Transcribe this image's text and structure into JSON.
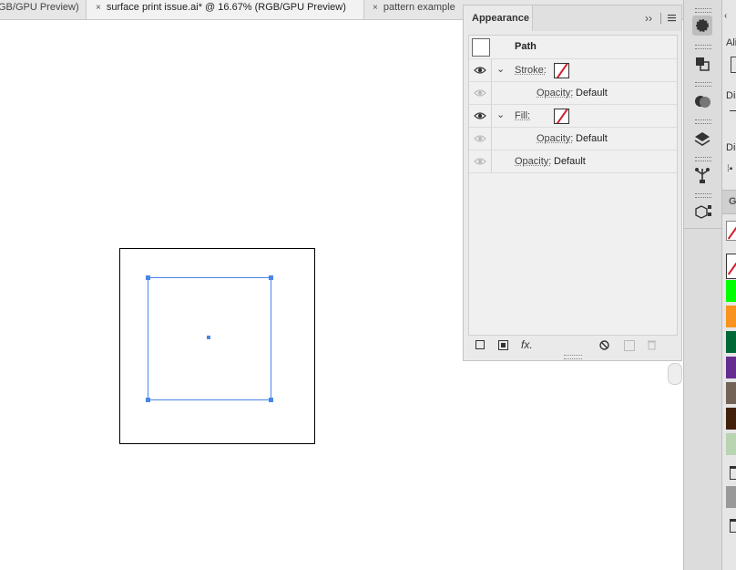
{
  "tabs": [
    {
      "label": "GB/GPU Preview)",
      "close": ""
    },
    {
      "label": "surface print issue.ai* @ 16.67% (RGB/GPU Preview)",
      "close": "×"
    },
    {
      "label": "pattern example",
      "close": "×"
    }
  ],
  "appearance_panel": {
    "title": "Appearance",
    "expand_glyph": "››",
    "object_label": "Path",
    "rows": [
      {
        "type": "stroke",
        "label": "Stroke:",
        "twisty": "⌄"
      },
      {
        "type": "opacity",
        "label": "Opacity:",
        "value": "Default"
      },
      {
        "type": "fill",
        "label": "Fill:",
        "twisty": "⌄"
      },
      {
        "type": "opacity",
        "label": "Opacity:",
        "value": "Default"
      },
      {
        "type": "opacity",
        "label": "Opacity:",
        "value": "Default"
      }
    ],
    "footer": {
      "fx_label": "fx."
    }
  },
  "right_panel_partial": {
    "labels": [
      "Ali",
      "Dis",
      "Dis",
      "G"
    ]
  },
  "colors": {
    "accent_selection": "#4a86e8",
    "none_slash": "#d0202a",
    "swatches": [
      "#00ff00",
      "#f7931e",
      "#006837",
      "#662d91",
      "#736357",
      "#42210b",
      "#999999"
    ]
  }
}
